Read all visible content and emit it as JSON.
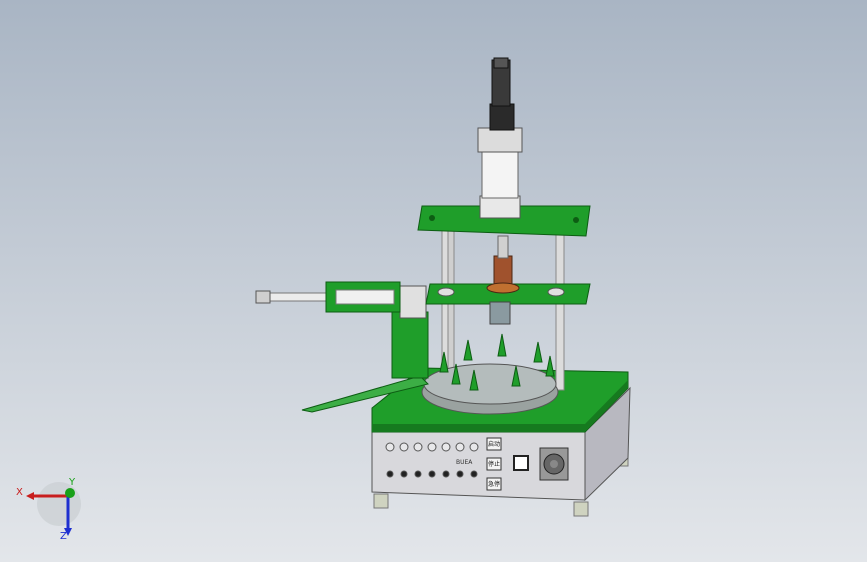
{
  "view": {
    "colors": {
      "accent": "#1f9e2a",
      "panel": "#d8d8dc",
      "frame": "#b8b8bf"
    }
  },
  "triad": {
    "x_label": "X",
    "y_label": "Y",
    "z_label": "Z"
  },
  "machine": {
    "control_panel": {
      "button_labels": [
        "启动",
        "停止",
        "急停"
      ],
      "center_text": "BUEA"
    }
  }
}
